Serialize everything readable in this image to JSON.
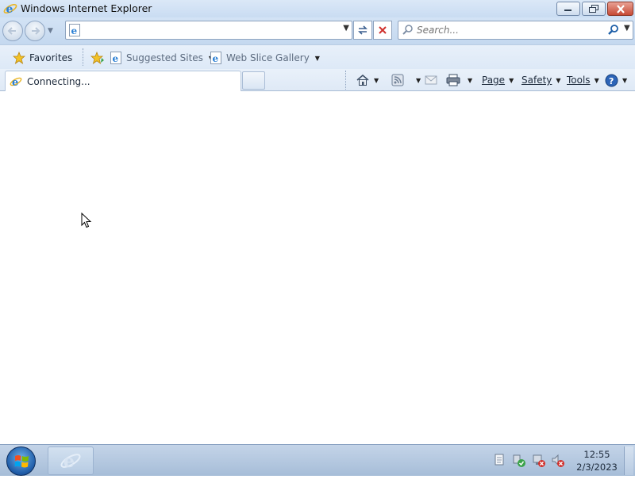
{
  "window": {
    "title": "Windows Internet Explorer"
  },
  "navigation": {
    "address_value": "",
    "search_placeholder": "Search..."
  },
  "favorites_bar": {
    "favorites_label": "Favorites",
    "items": [
      {
        "label": "Suggested Sites",
        "icon": "ie-page-icon"
      },
      {
        "label": "Web Slice Gallery",
        "icon": "ie-page-icon"
      }
    ]
  },
  "tabs": {
    "active_label": "Connecting..."
  },
  "command_bar": {
    "page_label": "Page",
    "safety_label": "Safety",
    "tools_label": "Tools"
  },
  "taskbar": {
    "time": "12:55",
    "date": "2/3/2023"
  },
  "colors": {
    "chrome_blue": "#c9dcf2",
    "close_red": "#c74a35",
    "taskbar": "#a6bdd8"
  }
}
